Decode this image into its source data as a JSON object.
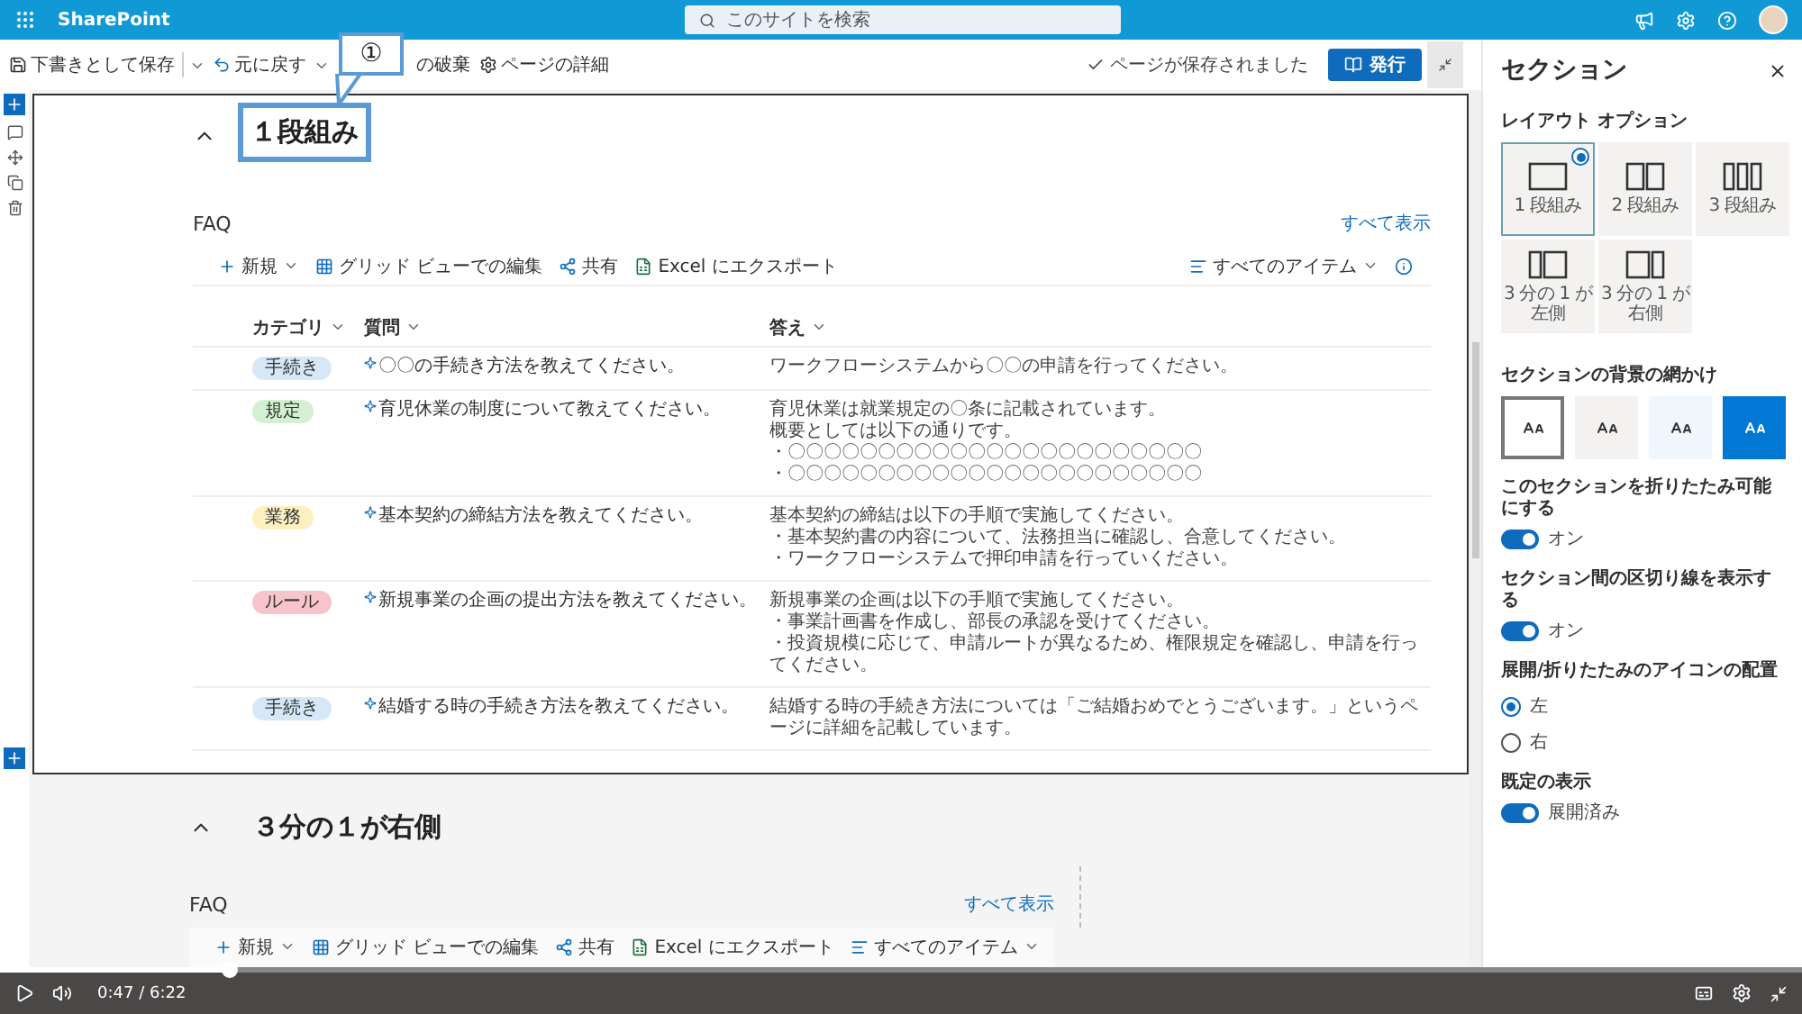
{
  "top_bar": {
    "app_name": "SharePoint",
    "search_placeholder": "このサイトを検索"
  },
  "command_bar": {
    "save_draft": "下書きとして保存",
    "undo": "元に戻す",
    "discard": "の破棄",
    "page_details": "ページの詳細",
    "status": "ページが保存されました",
    "publish": "発行"
  },
  "callout": {
    "number": "①",
    "label": "１段組み"
  },
  "sections": [
    {
      "kind": "one-column",
      "selected": true,
      "web_part": {
        "title": "FAQ",
        "see_all": "すべて表示",
        "toolbar": [
          {
            "kind": "new",
            "label": "新規"
          },
          {
            "kind": "grid",
            "label": "グリッド ビューでの編集"
          },
          {
            "kind": "share",
            "label": "共有"
          },
          {
            "kind": "export",
            "label": "Excel にエクスポート"
          }
        ],
        "view": "すべてのアイテム",
        "columns": [
          "カテゴリ",
          "質問",
          "答え"
        ],
        "rows": [
          {
            "category": "手続き",
            "color": "#d6e8f7",
            "question": "〇〇の手続き方法を教えてください。",
            "answer": [
              "ワークフローシステムから〇〇の申請を行ってください。"
            ]
          },
          {
            "category": "規定",
            "color": "#d3f0d0",
            "question": "育児休業の制度について教えてください。",
            "answer": [
              "育児休業は就業規定の〇条に記載されています。",
              "概要としては以下の通りです。",
              "・〇〇〇〇〇〇〇〇〇〇〇〇〇〇〇〇〇〇〇〇〇〇〇",
              "・〇〇〇〇〇〇〇〇〇〇〇〇〇〇〇〇〇〇〇〇〇〇〇"
            ]
          },
          {
            "category": "業務",
            "color": "#fcefc0",
            "question": "基本契約の締結方法を教えてください。",
            "answer": [
              "基本契約の締結は以下の手順で実施してください。",
              "・基本契約書の内容について、法務担当に確認し、合意してください。",
              "・ワークフローシステムで押印申請を行っていください。"
            ]
          },
          {
            "category": "ルール",
            "color": "#f7c4ca",
            "question": "新規事業の企画の提出方法を教えてください。",
            "answer": [
              "新規事業の企画は以下の手順で実施してください。",
              "・事業計画書を作成し、部長の承認を受けてください。",
              "・投資規模に応じて、申請ルートが異なるため、権限規定を確認し、申請を行ってください。"
            ]
          },
          {
            "category": "手続き",
            "color": "#d6e8f7",
            "question": "結婚する時の手続き方法を教えてください。",
            "answer": [
              "結婚する時の手続き方法については「ご結婚おめでとうございます。」というページに詳細を記載しています。"
            ]
          }
        ]
      }
    },
    {
      "kind": "third-right",
      "selected": false,
      "title": "３分の１が右側",
      "web_part": {
        "title": "FAQ",
        "see_all": "すべて表示",
        "toolbar": [
          {
            "kind": "new",
            "label": "新規"
          },
          {
            "kind": "grid",
            "label": "グリッド ビューでの編集"
          },
          {
            "kind": "share",
            "label": "共有"
          },
          {
            "kind": "export",
            "label": "Excel にエクスポート"
          }
        ],
        "view": "すべてのアイテム"
      }
    }
  ],
  "panel": {
    "title": "セクション",
    "layout_heading": "レイアウト オプション",
    "layouts": [
      {
        "kind": "one",
        "label": "1 段組み",
        "selected": true
      },
      {
        "kind": "two",
        "label": "2 段組み",
        "selected": false
      },
      {
        "kind": "three",
        "label": "3 段組み",
        "selected": false
      },
      {
        "kind": "third-left",
        "label": "3 分の 1 が左側",
        "selected": false
      },
      {
        "kind": "third-right",
        "label": "3 分の 1 が右側",
        "selected": false
      }
    ],
    "shading_heading": "セクションの背景の網かけ",
    "shadings": [
      {
        "color": "#ffffff",
        "selected": true
      },
      {
        "color": "#f3f2f1",
        "selected": false
      },
      {
        "color": "#eff6fc",
        "selected": false
      },
      {
        "color": "#0078d4",
        "selected": false
      }
    ],
    "settings": [
      {
        "kind": "toggle",
        "label": "このセクションを折りたたみ可能にする",
        "on": true,
        "state_label": "オン"
      },
      {
        "kind": "toggle",
        "label": "セクション間の区切り線を表示する",
        "on": true,
        "state_label": "オン"
      },
      {
        "kind": "radio",
        "label": "展開/折りたたみのアイコンの配置",
        "options": [
          {
            "label": "左",
            "selected": true
          },
          {
            "label": "右",
            "selected": false
          }
        ]
      },
      {
        "kind": "toggle",
        "label": "既定の表示",
        "on": true,
        "state_label": "展開済み"
      }
    ]
  },
  "video": {
    "time": "0:47 / 6:22",
    "level": 0.127
  }
}
